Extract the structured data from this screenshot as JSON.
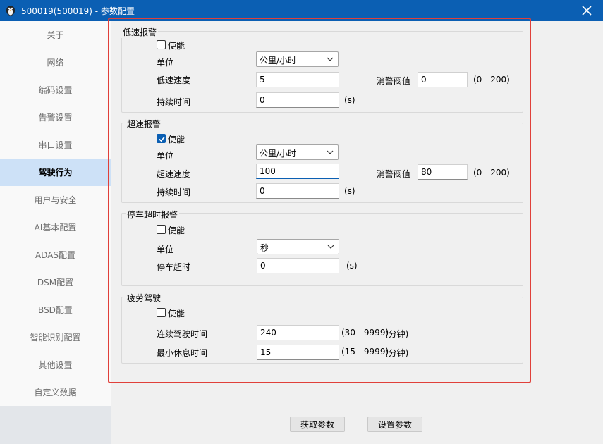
{
  "window": {
    "title": "500019(500019) - 参数配置",
    "close_symbol": "✕"
  },
  "sidebar": {
    "items": [
      {
        "label": "关于"
      },
      {
        "label": "网络"
      },
      {
        "label": "编码设置"
      },
      {
        "label": "告警设置"
      },
      {
        "label": "串口设置"
      },
      {
        "label": "驾驶行为",
        "active": true
      },
      {
        "label": "用户与安全"
      },
      {
        "label": "AI基本配置"
      },
      {
        "label": "ADAS配置"
      },
      {
        "label": "DSM配置"
      },
      {
        "label": "BSD配置"
      },
      {
        "label": "智能识别配置"
      },
      {
        "label": "其他设置"
      },
      {
        "label": "自定义数据"
      }
    ]
  },
  "low_speed": {
    "title": "低速报警",
    "enable_label": "使能",
    "enabled": false,
    "unit_label": "单位",
    "unit_value": "公里/小时",
    "speed_label": "低速速度",
    "speed_value": "5",
    "clear_label": "消警阀值",
    "clear_value": "0",
    "clear_range": "(0 - 200)",
    "duration_label": "持续时间",
    "duration_value": "0",
    "duration_unit": "(s)"
  },
  "over_speed": {
    "title": "超速报警",
    "enable_label": "使能",
    "enabled": true,
    "unit_label": "单位",
    "unit_value": "公里/小时",
    "speed_label": "超速速度",
    "speed_value": "100",
    "clear_label": "消警阀值",
    "clear_value": "80",
    "clear_range": "(0 - 200)",
    "duration_label": "持续时间",
    "duration_value": "0",
    "duration_unit": "(s)"
  },
  "parking": {
    "title": "停车超时报警",
    "enable_label": "使能",
    "enabled": false,
    "unit_label": "单位",
    "unit_value": "秒",
    "timeout_label": "停车超时",
    "timeout_value": "0",
    "timeout_unit": "(s)"
  },
  "fatigue": {
    "title": "疲劳驾驶",
    "enable_label": "使能",
    "enabled": false,
    "continuous_label": "连续驾驶时间",
    "continuous_value": "240",
    "continuous_range": "(30 - 9999)",
    "continuous_unit": "(分钟)",
    "rest_label": "最小休息时间",
    "rest_value": "15",
    "rest_range": "(15 - 9999)",
    "rest_unit": "(分钟)"
  },
  "buttons": {
    "get_label": "获取参数",
    "set_label": "设置参数"
  },
  "colors": {
    "titlebar": "#0b5fb3",
    "active_item": "#cde1f7",
    "highlight_border": "#e0403a"
  }
}
